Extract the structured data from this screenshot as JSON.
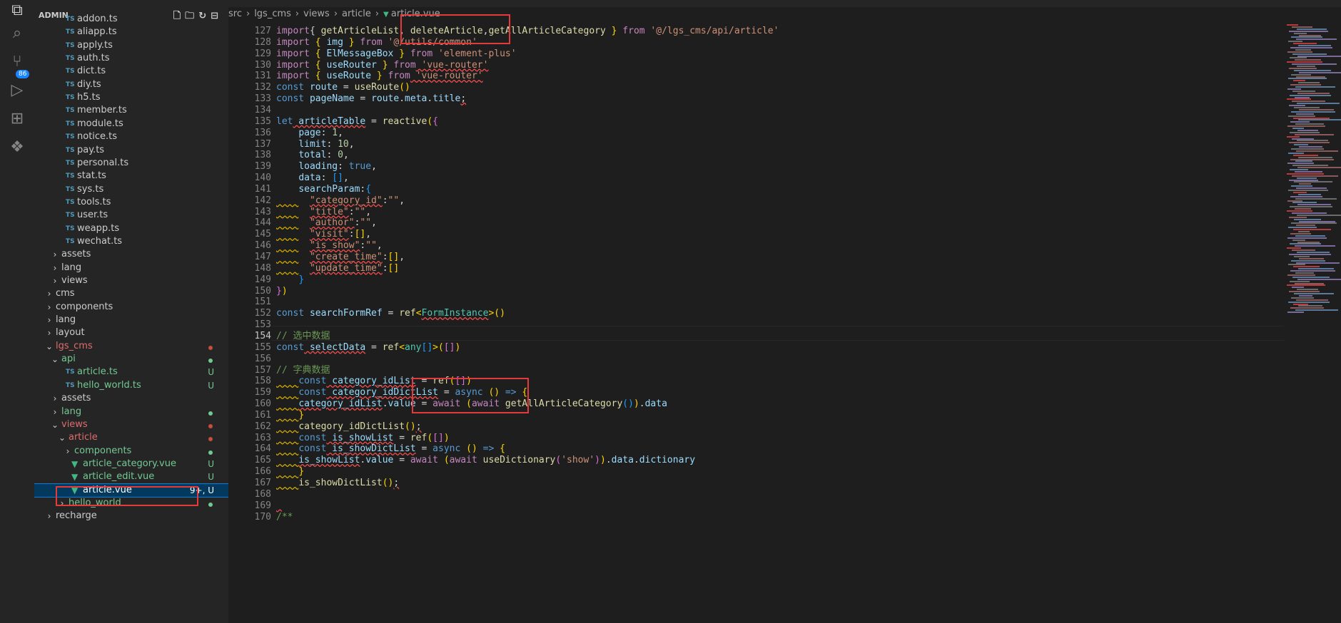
{
  "explorer": {
    "title": "ADMIN",
    "tree": [
      {
        "label": "addon.ts",
        "type": "ts",
        "indent": 2
      },
      {
        "label": "aliapp.ts",
        "type": "ts",
        "indent": 2
      },
      {
        "label": "apply.ts",
        "type": "ts",
        "indent": 2
      },
      {
        "label": "auth.ts",
        "type": "ts",
        "indent": 2
      },
      {
        "label": "dict.ts",
        "type": "ts",
        "indent": 2
      },
      {
        "label": "diy.ts",
        "type": "ts",
        "indent": 2
      },
      {
        "label": "h5.ts",
        "type": "ts",
        "indent": 2
      },
      {
        "label": "member.ts",
        "type": "ts",
        "indent": 2
      },
      {
        "label": "module.ts",
        "type": "ts",
        "indent": 2
      },
      {
        "label": "notice.ts",
        "type": "ts",
        "indent": 2
      },
      {
        "label": "pay.ts",
        "type": "ts",
        "indent": 2
      },
      {
        "label": "personal.ts",
        "type": "ts",
        "indent": 2
      },
      {
        "label": "stat.ts",
        "type": "ts",
        "indent": 2
      },
      {
        "label": "sys.ts",
        "type": "ts",
        "indent": 2
      },
      {
        "label": "tools.ts",
        "type": "ts",
        "indent": 2
      },
      {
        "label": "user.ts",
        "type": "ts",
        "indent": 2
      },
      {
        "label": "weapp.ts",
        "type": "ts",
        "indent": 2
      },
      {
        "label": "wechat.ts",
        "type": "ts",
        "indent": 2
      },
      {
        "label": "assets",
        "type": "folder",
        "indent": 1,
        "open": false
      },
      {
        "label": "lang",
        "type": "folder",
        "indent": 1,
        "open": false
      },
      {
        "label": "views",
        "type": "folder",
        "indent": 1,
        "open": false
      },
      {
        "label": "cms",
        "type": "folder",
        "indent": 0,
        "open": false
      },
      {
        "label": "components",
        "type": "folder",
        "indent": 0,
        "open": false
      },
      {
        "label": "lang",
        "type": "folder",
        "indent": 0,
        "open": false
      },
      {
        "label": "layout",
        "type": "folder",
        "indent": 0,
        "open": false
      },
      {
        "label": "lgs_cms",
        "type": "folder",
        "indent": 0,
        "open": true,
        "color": "#e06c6c",
        "dot": "#c74e39"
      },
      {
        "label": "api",
        "type": "folder",
        "indent": 1,
        "open": true,
        "color": "#73c991",
        "dot": "#73c991"
      },
      {
        "label": "article.ts",
        "type": "ts",
        "indent": 2,
        "color": "#73c991",
        "status": "U"
      },
      {
        "label": "hello_world.ts",
        "type": "ts",
        "indent": 2,
        "color": "#73c991",
        "status": "U"
      },
      {
        "label": "assets",
        "type": "folder",
        "indent": 1,
        "open": false
      },
      {
        "label": "lang",
        "type": "folder",
        "indent": 1,
        "open": false,
        "color": "#73c991",
        "dot": "#73c991"
      },
      {
        "label": "views",
        "type": "folder",
        "indent": 1,
        "open": true,
        "color": "#e06c6c",
        "dot": "#c74e39"
      },
      {
        "label": "article",
        "type": "folder",
        "indent": 2,
        "open": true,
        "color": "#e06c6c",
        "dot": "#c74e39"
      },
      {
        "label": "components",
        "type": "folder",
        "indent": 3,
        "open": false,
        "color": "#73c991",
        "dot": "#73c991"
      },
      {
        "label": "article_category.vue",
        "type": "vue",
        "indent": 3,
        "color": "#73c991",
        "status": "U"
      },
      {
        "label": "article_edit.vue",
        "type": "vue",
        "indent": 3,
        "color": "#73c991",
        "status": "U"
      },
      {
        "label": "article.vue",
        "type": "vue",
        "indent": 3,
        "color": "#ffffff",
        "status": "9+, U",
        "selected": true
      },
      {
        "label": "hello_world",
        "type": "folder",
        "indent": 2,
        "open": false,
        "color": "#73c991",
        "dot": "#73c991"
      },
      {
        "label": "recharge",
        "type": "folder",
        "indent": 0,
        "open": false
      }
    ]
  },
  "breadcrumb": [
    "src",
    "lgs_cms",
    "views",
    "article",
    "article.vue"
  ],
  "scm_badge": "86",
  "lines": [
    {
      "n": "127",
      "segs": [
        [
          "k",
          "import"
        ],
        [
          "",
          "{ "
        ],
        [
          "f",
          "getArticleList"
        ],
        [
          "",
          ", "
        ],
        [
          "f",
          "deleteArticle"
        ],
        [
          "",
          ","
        ],
        [
          "f",
          "getAllArticleCategory"
        ],
        [
          "",
          ""
        ],
        [
          "p",
          " }"
        ],
        [
          "k",
          " from"
        ],
        [
          "s",
          " '@/lgs_cms/api/article'"
        ]
      ]
    },
    {
      "n": "128",
      "segs": [
        [
          "k",
          "import"
        ],
        [
          "",
          ""
        ],
        [
          "p",
          " {"
        ],
        [
          "v",
          " img"
        ],
        [
          "p",
          " }"
        ],
        [
          "k",
          " from"
        ],
        [
          "s",
          " '@/utils/common'"
        ]
      ]
    },
    {
      "n": "129",
      "segs": [
        [
          "k",
          "import"
        ],
        [
          "",
          ""
        ],
        [
          "p",
          " {"
        ],
        [
          "v",
          " ElMessageBox"
        ],
        [
          "p",
          " }"
        ],
        [
          "k",
          " from"
        ],
        [
          "s",
          " 'element-plus'"
        ]
      ]
    },
    {
      "n": "130",
      "segs": [
        [
          "k",
          "import"
        ],
        [
          "",
          ""
        ],
        [
          "p",
          " {"
        ],
        [
          "v",
          " useRouter"
        ],
        [
          "p",
          " }"
        ],
        [
          "k",
          " from"
        ],
        [
          "s sq",
          " 'vue-router'"
        ]
      ]
    },
    {
      "n": "131",
      "segs": [
        [
          "k",
          "import"
        ],
        [
          "",
          ""
        ],
        [
          "p",
          " {"
        ],
        [
          "v",
          " useRoute"
        ],
        [
          "p",
          " }"
        ],
        [
          "k",
          " from"
        ],
        [
          "s sq",
          " 'vue-router'"
        ]
      ]
    },
    {
      "n": "132",
      "segs": [
        [
          "kb",
          "const"
        ],
        [
          "v",
          " route"
        ],
        [
          "",
          " = "
        ],
        [
          "f",
          "useRoute"
        ],
        [
          "p",
          "()"
        ]
      ]
    },
    {
      "n": "133",
      "segs": [
        [
          "kb",
          "const"
        ],
        [
          "v",
          " pageName"
        ],
        [
          "",
          " = "
        ],
        [
          "v",
          "route"
        ],
        [
          "",
          "."
        ],
        [
          "v",
          "meta"
        ],
        [
          "",
          "."
        ],
        [
          "v",
          "title"
        ],
        [
          "sq",
          ";"
        ]
      ]
    },
    {
      "n": "134",
      "segs": []
    },
    {
      "n": "135",
      "segs": [
        [
          "kb",
          "let"
        ],
        [
          "v sq",
          " articleTable"
        ],
        [
          "",
          " = "
        ],
        [
          "f",
          "reactive"
        ],
        [
          "p",
          "("
        ],
        [
          "pp",
          "{"
        ]
      ]
    },
    {
      "n": "136",
      "segs": [
        [
          "",
          "    "
        ],
        [
          "v",
          "page"
        ],
        [
          "",
          ": "
        ],
        [
          "n",
          "1"
        ],
        [
          "",
          ","
        ]
      ]
    },
    {
      "n": "137",
      "segs": [
        [
          "",
          "    "
        ],
        [
          "v",
          "limit"
        ],
        [
          "",
          ": "
        ],
        [
          "n",
          "10"
        ],
        [
          "",
          ","
        ]
      ]
    },
    {
      "n": "138",
      "segs": [
        [
          "",
          "    "
        ],
        [
          "v",
          "total"
        ],
        [
          "",
          ": "
        ],
        [
          "n",
          "0"
        ],
        [
          "",
          ","
        ]
      ]
    },
    {
      "n": "139",
      "segs": [
        [
          "",
          "    "
        ],
        [
          "v",
          "loading"
        ],
        [
          "",
          ": "
        ],
        [
          "kb",
          "true"
        ],
        [
          "",
          ","
        ]
      ]
    },
    {
      "n": "140",
      "segs": [
        [
          "",
          "    "
        ],
        [
          "v",
          "data"
        ],
        [
          "",
          ": "
        ],
        [
          "pb",
          "[]"
        ],
        [
          "",
          ","
        ]
      ]
    },
    {
      "n": "141",
      "segs": [
        [
          "",
          "    "
        ],
        [
          "v",
          "searchParam"
        ],
        [
          "",
          ":"
        ],
        [
          "pb",
          "{"
        ]
      ]
    },
    {
      "n": "142",
      "segs": [
        [
          "sqy",
          "    "
        ],
        [
          "",
          "  "
        ],
        [
          "s sq",
          "\"category_id\""
        ],
        [
          "",
          ":"
        ],
        [
          "s",
          "\"\""
        ],
        [
          "",
          ","
        ]
      ]
    },
    {
      "n": "143",
      "segs": [
        [
          "sqy",
          "    "
        ],
        [
          "",
          "  "
        ],
        [
          "s sq",
          "\"title\""
        ],
        [
          "",
          ":"
        ],
        [
          "s",
          "\"\""
        ],
        [
          "",
          ","
        ]
      ]
    },
    {
      "n": "144",
      "segs": [
        [
          "sqy",
          "    "
        ],
        [
          "",
          "  "
        ],
        [
          "s sq",
          "\"author\""
        ],
        [
          "",
          ":"
        ],
        [
          "s",
          "\"\""
        ],
        [
          "",
          ","
        ]
      ]
    },
    {
      "n": "145",
      "segs": [
        [
          "sqy",
          "    "
        ],
        [
          "",
          "  "
        ],
        [
          "s sq",
          "\"visit\""
        ],
        [
          "",
          ":"
        ],
        [
          "p",
          "[]"
        ],
        [
          "",
          ","
        ]
      ]
    },
    {
      "n": "146",
      "segs": [
        [
          "sqy",
          "    "
        ],
        [
          "",
          "  "
        ],
        [
          "s sq",
          "\"is_show\""
        ],
        [
          "",
          ":"
        ],
        [
          "s",
          "\"\""
        ],
        [
          "",
          ","
        ]
      ]
    },
    {
      "n": "147",
      "segs": [
        [
          "sqy",
          "    "
        ],
        [
          "",
          "  "
        ],
        [
          "s sq",
          "\"create_time\""
        ],
        [
          "",
          ":"
        ],
        [
          "p",
          "[]"
        ],
        [
          "",
          ","
        ]
      ]
    },
    {
      "n": "148",
      "segs": [
        [
          "sqy",
          "    "
        ],
        [
          "",
          "  "
        ],
        [
          "s sq",
          "\"update_time\""
        ],
        [
          "",
          ":"
        ],
        [
          "p",
          "[]"
        ]
      ]
    },
    {
      "n": "149",
      "segs": [
        [
          "",
          "    "
        ],
        [
          "pb",
          "}"
        ]
      ]
    },
    {
      "n": "150",
      "segs": [
        [
          "pp",
          "}"
        ],
        [
          "p",
          ")"
        ]
      ]
    },
    {
      "n": "151",
      "segs": []
    },
    {
      "n": "152",
      "segs": [
        [
          "kb",
          "const"
        ],
        [
          "v",
          " searchFormRef"
        ],
        [
          "",
          " = "
        ],
        [
          "f",
          "ref"
        ],
        [
          "p",
          "<"
        ],
        [
          "t sq",
          "FormInstance"
        ],
        [
          "p",
          ">"
        ],
        [
          "p",
          "()"
        ]
      ]
    },
    {
      "n": "153",
      "segs": []
    },
    {
      "n": "154",
      "segs": [
        [
          "c",
          "// 选中数据"
        ]
      ],
      "current": true
    },
    {
      "n": "155",
      "segs": [
        [
          "kb",
          "const"
        ],
        [
          "v sq",
          " selectData"
        ],
        [
          "",
          " = "
        ],
        [
          "f",
          "ref"
        ],
        [
          "",
          ""
        ],
        [
          "p",
          "<"
        ],
        [
          "t",
          "any"
        ],
        [
          "pb",
          "[]"
        ],
        [
          "p",
          ">"
        ],
        [
          "p",
          "("
        ],
        [
          "pp",
          "[]"
        ],
        [
          "p",
          ")"
        ]
      ]
    },
    {
      "n": "156",
      "segs": []
    },
    {
      "n": "157",
      "segs": [
        [
          "c",
          "// 字典数据"
        ]
      ]
    },
    {
      "n": "158",
      "segs": [
        [
          "sqy",
          "    "
        ],
        [
          "kb",
          "const"
        ],
        [
          "v sq",
          " category_idList"
        ],
        [
          "",
          " = "
        ],
        [
          "f",
          "ref"
        ],
        [
          "p",
          "("
        ],
        [
          "pp",
          "[]"
        ],
        [
          "p",
          ")"
        ]
      ]
    },
    {
      "n": "159",
      "segs": [
        [
          "sqy",
          "    "
        ],
        [
          "kb",
          "const"
        ],
        [
          "v sq",
          " category_idDictList"
        ],
        [
          "",
          " = "
        ],
        [
          "kb",
          "async"
        ],
        [
          "p",
          " ()"
        ],
        [
          "kb",
          " =>"
        ],
        [
          "p",
          " {"
        ]
      ]
    },
    {
      "n": "160",
      "segs": [
        [
          "sqy",
          "    "
        ],
        [
          "v sq",
          "category_idList"
        ],
        [
          "",
          "."
        ],
        [
          "v",
          "value"
        ],
        [
          "",
          " = "
        ],
        [
          "k",
          "await"
        ],
        [
          "",
          ""
        ],
        [
          "p",
          " ("
        ],
        [
          "k",
          "await"
        ],
        [
          "f",
          " getAllArticleCategory"
        ],
        [
          "pb",
          "()"
        ],
        [
          "p",
          ")"
        ],
        [
          "",
          "."
        ],
        [
          "v",
          "data"
        ]
      ]
    },
    {
      "n": "161",
      "segs": [
        [
          "sqy",
          "    "
        ],
        [
          "p",
          "}"
        ]
      ]
    },
    {
      "n": "162",
      "segs": [
        [
          "sqy",
          "    "
        ],
        [
          "f",
          "category_idDictList"
        ],
        [
          "p",
          "()"
        ],
        [
          "sq",
          ";"
        ]
      ]
    },
    {
      "n": "163",
      "segs": [
        [
          "sqy",
          "    "
        ],
        [
          "kb",
          "const"
        ],
        [
          "v sq",
          " is_showList"
        ],
        [
          "",
          " = "
        ],
        [
          "f",
          "ref"
        ],
        [
          "p",
          "("
        ],
        [
          "pp",
          "[]"
        ],
        [
          "p",
          ")"
        ]
      ]
    },
    {
      "n": "164",
      "segs": [
        [
          "sqy",
          "    "
        ],
        [
          "kb",
          "const"
        ],
        [
          "v sq",
          " is_showDictList"
        ],
        [
          "",
          " = "
        ],
        [
          "kb",
          "async"
        ],
        [
          "p",
          " ()"
        ],
        [
          "kb",
          " =>"
        ],
        [
          "p",
          " {"
        ]
      ]
    },
    {
      "n": "165",
      "segs": [
        [
          "sqy",
          "    "
        ],
        [
          "v sq",
          "is_showList"
        ],
        [
          "",
          "."
        ],
        [
          "v",
          "value"
        ],
        [
          "",
          " = "
        ],
        [
          "k",
          "await"
        ],
        [
          "p",
          " ("
        ],
        [
          "k",
          "await"
        ],
        [
          "f",
          " useDictionary"
        ],
        [
          "pp",
          "("
        ],
        [
          "s",
          "'show'"
        ],
        [
          "pp",
          ")"
        ],
        [
          "p",
          ")"
        ],
        [
          "",
          "."
        ],
        [
          "v",
          "data"
        ],
        [
          "",
          "."
        ],
        [
          "v",
          "dictionary"
        ]
      ]
    },
    {
      "n": "166",
      "segs": [
        [
          "sqy",
          "    "
        ],
        [
          "p",
          "}"
        ]
      ]
    },
    {
      "n": "167",
      "segs": [
        [
          "sqy",
          "    "
        ],
        [
          "f",
          "is_showDictList"
        ],
        [
          "p",
          "()"
        ],
        [
          "sq",
          ";"
        ]
      ]
    },
    {
      "n": "168",
      "segs": []
    },
    {
      "n": "169",
      "segs": [
        [
          "sq",
          " "
        ]
      ]
    },
    {
      "n": "170",
      "segs": [
        [
          "c",
          "/**"
        ]
      ]
    }
  ],
  "colors": {
    "accent": "#007fd4",
    "highlight_box": "#e5393c"
  }
}
